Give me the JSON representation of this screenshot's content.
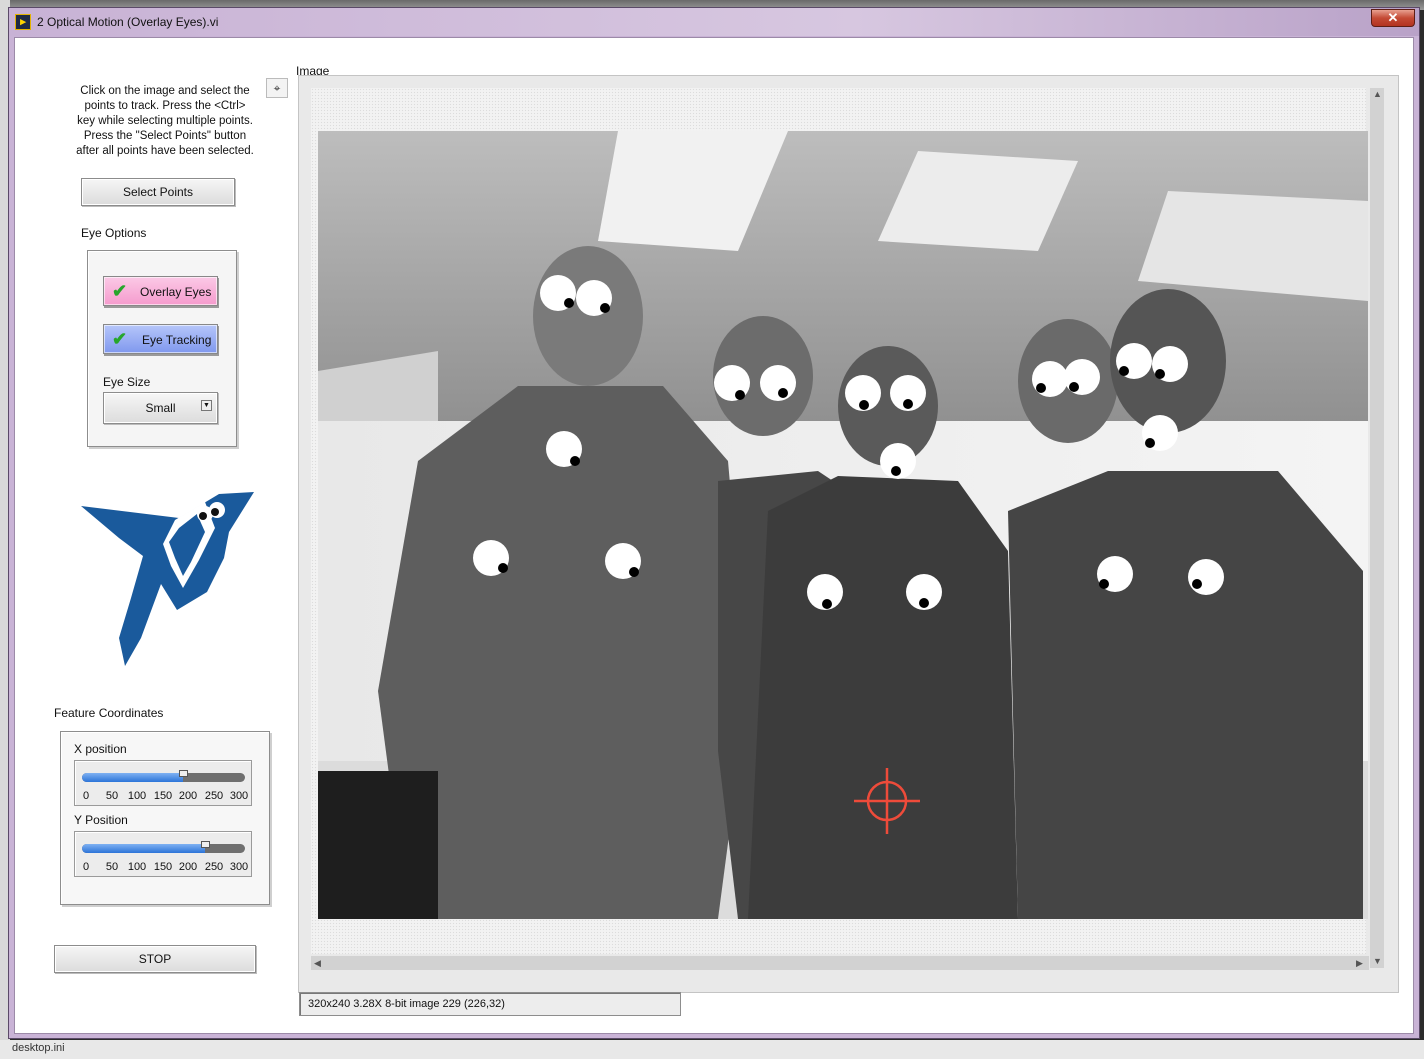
{
  "window": {
    "title": "2 Optical Motion (Overlay Eyes).vi",
    "close_glyph": "✕"
  },
  "desktop": {
    "taskbar_text": "desktop.ini"
  },
  "instructions": "Click on the image and select the points to track. Press the <Ctrl> key while selecting multiple points. Press the \"Select Points\" button after  all points have been selected.",
  "select_points_button": "Select Points",
  "eye_options": {
    "label": "Eye Options",
    "overlay_eyes": {
      "label": "Overlay Eyes",
      "checked": true,
      "color": "#f7a7d3"
    },
    "eye_tracking": {
      "label": "Eye Tracking",
      "checked": true,
      "color": "#8fa6f2"
    },
    "eye_size_label": "Eye Size",
    "eye_size_value": "Small"
  },
  "feature_coordinates": {
    "label": "Feature Coordinates",
    "x_position": {
      "label": "X position",
      "value": 185,
      "min": 0,
      "max": 300
    },
    "y_position": {
      "label": "Y Position",
      "value": 226,
      "min": 0,
      "max": 300
    },
    "ticks": [
      "0",
      "50",
      "100",
      "150",
      "200",
      "250",
      "300"
    ]
  },
  "stop_button": "STOP",
  "image": {
    "label": "Image",
    "status_text": "320x240 3.28X 8-bit image 229    (226,32)",
    "zoom_tool_icon": "zoom-crosshair-icon"
  },
  "colors": {
    "ni_logo_blue": "#1a5a9c",
    "crosshair_red": "#ee4b3a",
    "window_frame": "#c9b3d6"
  }
}
